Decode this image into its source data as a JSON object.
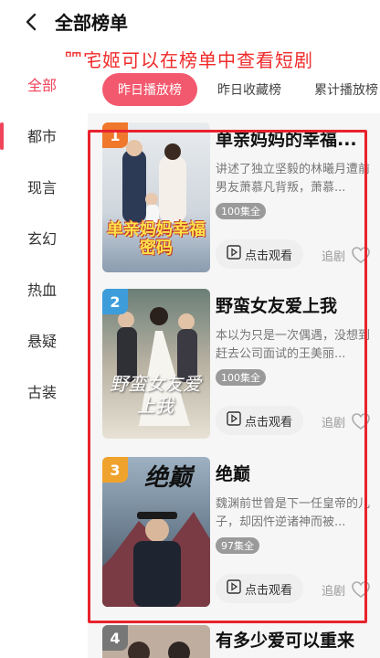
{
  "header": {
    "title": "全部榜单"
  },
  "annotation": "肥宅姬可以在榜单中查看短剧",
  "sidebar": {
    "items": [
      {
        "label": "全部",
        "active": true
      },
      {
        "label": "都市",
        "active": false
      },
      {
        "label": "现言",
        "active": false
      },
      {
        "label": "玄幻",
        "active": false
      },
      {
        "label": "热血",
        "active": false
      },
      {
        "label": "悬疑",
        "active": false
      },
      {
        "label": "古装",
        "active": false
      }
    ]
  },
  "tabs": [
    {
      "label": "昨日播放榜",
      "active": true
    },
    {
      "label": "昨日收藏榜",
      "active": false
    },
    {
      "label": "累计播放榜",
      "active": false
    }
  ],
  "cards": [
    {
      "rank": "1",
      "title": "单亲妈妈的幸福...",
      "desc": "讲述了独立坚毅的林曦月遭前男友萧慕凡背叛，萧慕...",
      "episodes": "100集全",
      "watch": "点击观看",
      "follow": "追剧",
      "poster_text": "单亲妈妈幸福密码"
    },
    {
      "rank": "2",
      "title": "野蛮女友爱上我",
      "desc": "本以为只是一次偶遇，没想到赶去公司面试的王美丽...",
      "episodes": "100集全",
      "watch": "点击观看",
      "follow": "追剧",
      "poster_text": "野蛮女友爱上我"
    },
    {
      "rank": "3",
      "title": "绝巅",
      "desc": "魏渊前世曾是下一任皇帝的儿子，却因忤逆诸神而被...",
      "episodes": "97集全",
      "watch": "点击观看",
      "follow": "追剧",
      "poster_text": "绝巅"
    },
    {
      "rank": "4",
      "title": "有多少爱可以重来"
    }
  ],
  "colors": {
    "accent": "#f0445b",
    "annotation_red": "#e8232e"
  }
}
